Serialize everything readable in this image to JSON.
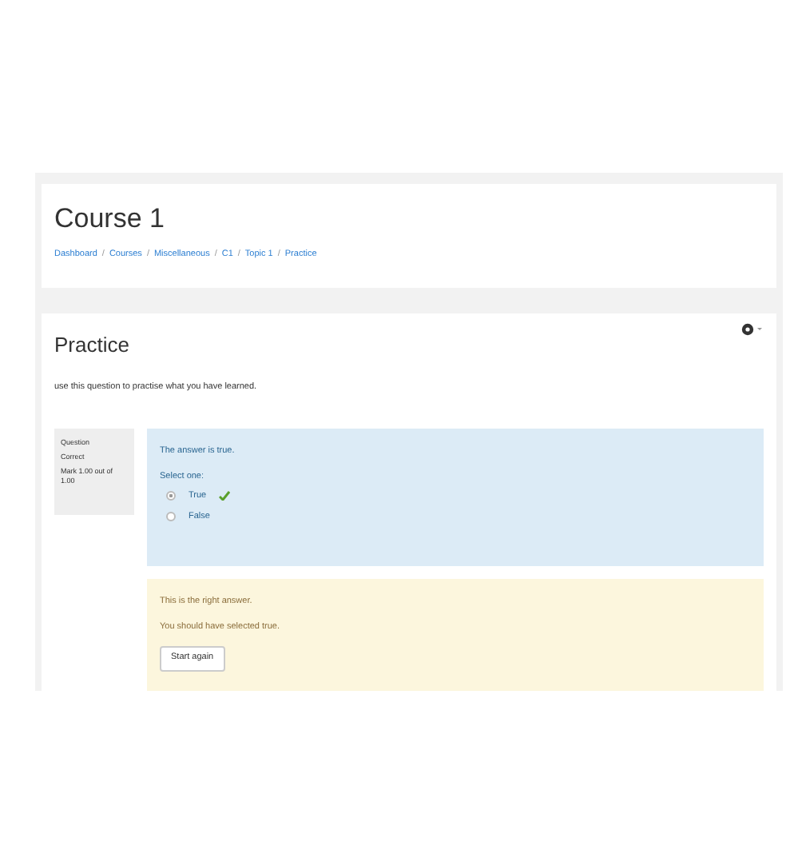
{
  "header": {
    "title": "Course 1",
    "breadcrumb": [
      "Dashboard",
      "Courses",
      "Miscellaneous",
      "C1",
      "Topic 1",
      "Practice"
    ],
    "separator": "/"
  },
  "activity": {
    "title": "Practice",
    "description": "use this question to practise what you have learned.",
    "question_info": [
      "Question",
      "Correct",
      "Mark 1.00 out of 1.00"
    ],
    "question": {
      "text": "The answer is true.",
      "prompt": "Select one:",
      "options": [
        {
          "label": "True",
          "selected": true,
          "correct": true
        },
        {
          "label": "False",
          "selected": false,
          "correct": false
        }
      ]
    },
    "feedback": [
      "This is the right answer.",
      "You should have selected true."
    ],
    "button": "Start again"
  }
}
